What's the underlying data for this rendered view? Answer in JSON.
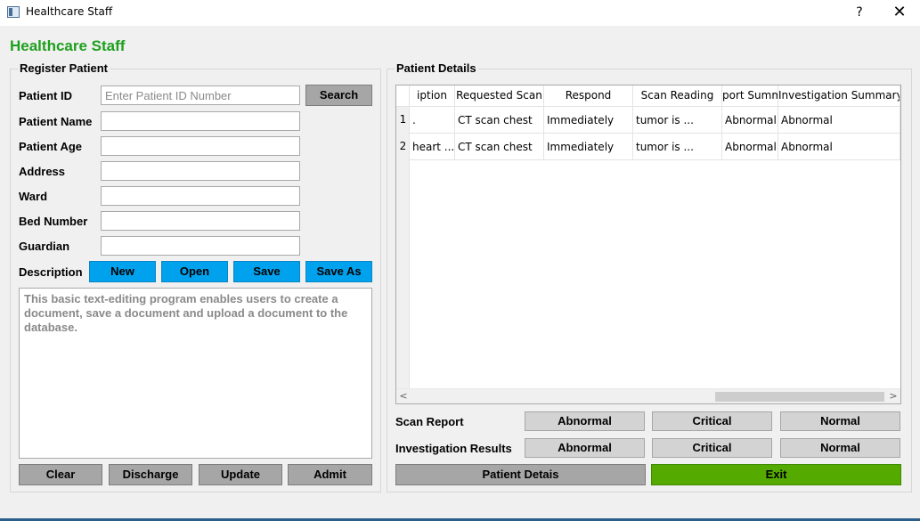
{
  "window": {
    "title": "Healthcare Staff",
    "help_glyph": "?",
    "close_glyph": "✕"
  },
  "header": {
    "title": "Healthcare Staff"
  },
  "register": {
    "group_title": "Register Patient",
    "fields": {
      "patient_id": {
        "label": "Patient ID",
        "value": "",
        "placeholder": "Enter Patient ID Number"
      },
      "patient_name": {
        "label": "Patient Name",
        "value": ""
      },
      "patient_age": {
        "label": "Patient Age",
        "value": ""
      },
      "address": {
        "label": "Address",
        "value": ""
      },
      "ward": {
        "label": "Ward",
        "value": ""
      },
      "bed_number": {
        "label": "Bed Number",
        "value": ""
      },
      "guardian": {
        "label": "Guardian",
        "value": ""
      }
    },
    "search_label": "Search",
    "description_label": "Description",
    "desc_buttons": {
      "new": "New",
      "open": "Open",
      "save": "Save",
      "save_as": "Save As"
    },
    "description_text": "This basic text-editing program enables users to create a document, save a document and upload a document to the database.",
    "actions": {
      "clear": "Clear",
      "discharge": "Discharge",
      "update": "Update",
      "admit": "Admit"
    }
  },
  "details": {
    "group_title": "Patient Details",
    "table": {
      "headers": [
        "iption",
        "Requested Scan",
        "Respond",
        "Scan Reading",
        "port Summ",
        "Investigation Summary"
      ],
      "rows": [
        {
          "num": "1",
          "cells": [
            ".",
            "CT scan chest",
            "Immediately",
            "tumor is ...",
            "Abnormal",
            "Abnormal"
          ]
        },
        {
          "num": "2",
          "cells": [
            "heart ...",
            "CT scan chest",
            "Immediately",
            "tumor is ...",
            "Abnormal",
            "Abnormal"
          ]
        }
      ],
      "scroll_left": "<",
      "scroll_right": ">"
    },
    "scan_report": {
      "label": "Scan Report",
      "abnormal": "Abnormal",
      "critical": "Critical",
      "normal": "Normal"
    },
    "investigation": {
      "label": "Investigation Results",
      "abnormal": "Abnormal",
      "critical": "Critical",
      "normal": "Normal"
    },
    "patient_details_btn": "Patient Detais",
    "exit_btn": "Exit"
  },
  "colors": {
    "accent_green": "#1ea01e",
    "button_blue": "#00a2ed",
    "exit_green": "#55aa00"
  }
}
